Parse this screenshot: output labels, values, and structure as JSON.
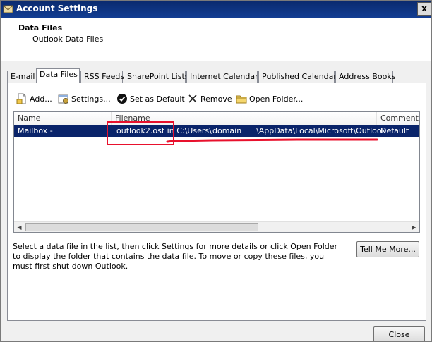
{
  "window": {
    "title": "Account Settings",
    "close_glyph": "x"
  },
  "header": {
    "title": "Data Files",
    "subtitle": "Outlook Data Files"
  },
  "tabs": [
    {
      "label": "E-mail",
      "active": false
    },
    {
      "label": "Data Files",
      "active": true
    },
    {
      "label": "RSS Feeds",
      "active": false
    },
    {
      "label": "SharePoint Lists",
      "active": false
    },
    {
      "label": "Internet Calendars",
      "active": false
    },
    {
      "label": "Published Calendars",
      "active": false
    },
    {
      "label": "Address Books",
      "active": false
    }
  ],
  "toolbar": {
    "add": "Add...",
    "settings": "Settings...",
    "set_default": "Set as Default",
    "remove": "Remove",
    "open_folder": "Open Folder..."
  },
  "list": {
    "columns": [
      "Name",
      "Filename",
      "Comment"
    ],
    "rows": [
      {
        "name": "Mailbox -",
        "filename_part1": "outlook2.ost in C:\\Users\\",
        "filename_part2": "domain",
        "filename_part3": "\\AppData\\Local\\Microsoft\\Outlook",
        "comment": "Default"
      }
    ]
  },
  "description": "Select a data file in the list, then click Settings for more details or click Open Folder to display the folder that contains the data file. To move or copy these files, you must first shut down Outlook.",
  "buttons": {
    "tell_me_more": "Tell Me More...",
    "close": "Close"
  },
  "colors": {
    "title_bar": "#0a2a6e",
    "selection": "#0a246a",
    "annotation": "#e8112d"
  }
}
